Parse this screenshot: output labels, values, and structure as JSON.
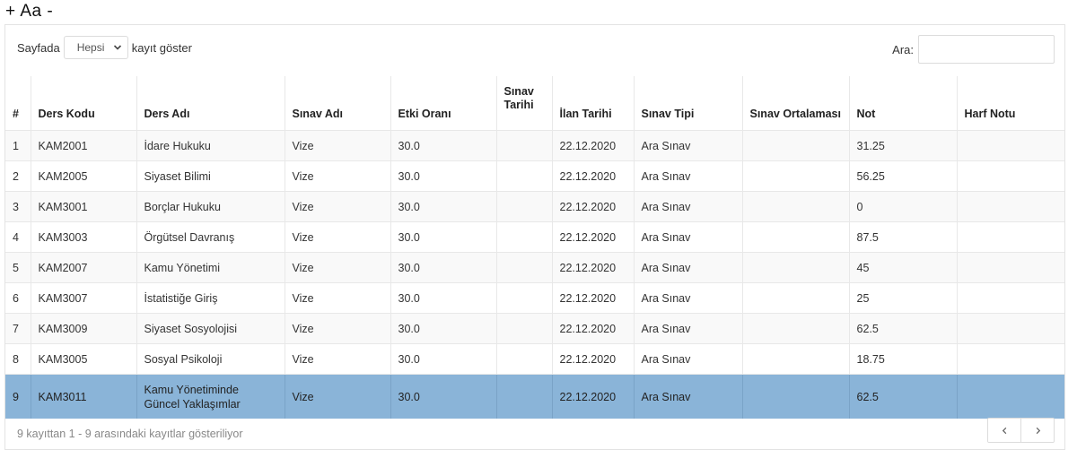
{
  "font_controls": {
    "increase": "+",
    "label": "Aa",
    "decrease": "-"
  },
  "length_control": {
    "prefix": "Sayfada",
    "selected": "Hepsi",
    "suffix": "kayıt göster"
  },
  "search": {
    "label": "Ara:",
    "value": ""
  },
  "table": {
    "columns": [
      "#",
      "Ders Kodu",
      "Ders Adı",
      "Sınav Adı",
      "Etki Oranı",
      "Sınav Tarihi",
      "İlan Tarihi",
      "Sınav Tipi",
      "Sınav Ortalaması",
      "Not",
      "Harf Notu"
    ],
    "rows": [
      [
        "1",
        "KAM2001",
        "İdare Hukuku",
        "Vize",
        "30.0",
        "",
        "22.12.2020",
        "Ara Sınav",
        "",
        "31.25",
        ""
      ],
      [
        "2",
        "KAM2005",
        "Siyaset Bilimi",
        "Vize",
        "30.0",
        "",
        "22.12.2020",
        "Ara Sınav",
        "",
        "56.25",
        ""
      ],
      [
        "3",
        "KAM3001",
        "Borçlar Hukuku",
        "Vize",
        "30.0",
        "",
        "22.12.2020",
        "Ara Sınav",
        "",
        "0",
        ""
      ],
      [
        "4",
        "KAM3003",
        "Örgütsel Davranış",
        "Vize",
        "30.0",
        "",
        "22.12.2020",
        "Ara Sınav",
        "",
        "87.5",
        ""
      ],
      [
        "5",
        "KAM2007",
        "Kamu Yönetimi",
        "Vize",
        "30.0",
        "",
        "22.12.2020",
        "Ara Sınav",
        "",
        "45",
        ""
      ],
      [
        "6",
        "KAM3007",
        "İstatistiğe Giriş",
        "Vize",
        "30.0",
        "",
        "22.12.2020",
        "Ara Sınav",
        "",
        "25",
        ""
      ],
      [
        "7",
        "KAM3009",
        "Siyaset Sosyolojisi",
        "Vize",
        "30.0",
        "",
        "22.12.2020",
        "Ara Sınav",
        "",
        "62.5",
        ""
      ],
      [
        "8",
        "KAM3005",
        "Sosyal Psikoloji",
        "Vize",
        "30.0",
        "",
        "22.12.2020",
        "Ara Sınav",
        "",
        "18.75",
        ""
      ],
      [
        "9",
        "KAM3011",
        "Kamu Yönetiminde Güncel Yaklaşımlar",
        "Vize",
        "30.0",
        "",
        "22.12.2020",
        "Ara Sınav",
        "",
        "62.5",
        ""
      ]
    ],
    "selected_row": 8
  },
  "info_text": "9 kayıttan 1 - 9 arasındaki kayıtlar gösteriliyor",
  "pager": {
    "prev_icon": "chevron-left-icon",
    "next_icon": "chevron-right-icon"
  },
  "colors": {
    "selected_row": "#8ab4d8",
    "stripe": "#f9f9f9",
    "border": "#e8e8e8"
  }
}
